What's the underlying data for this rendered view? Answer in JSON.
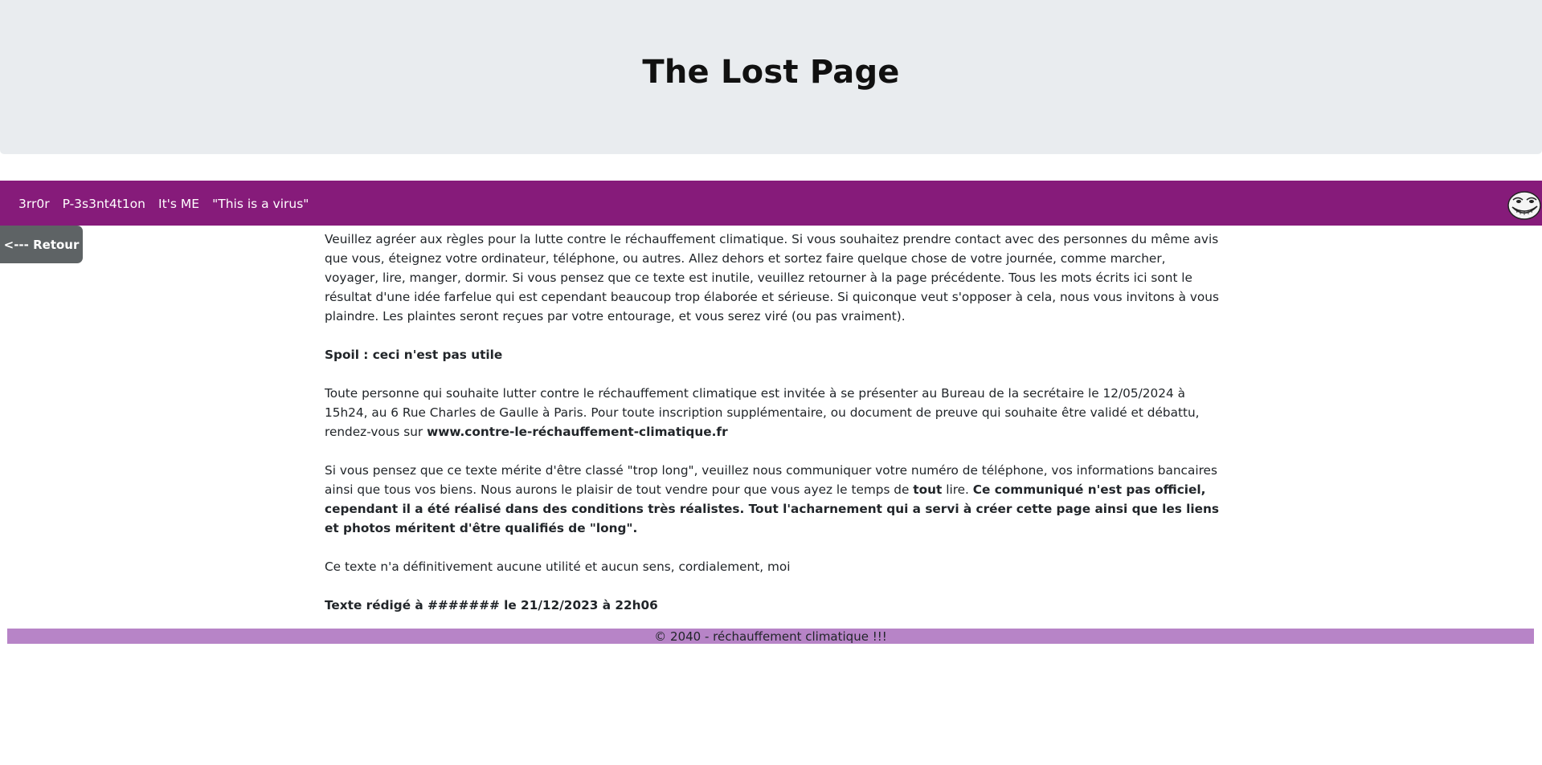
{
  "header": {
    "title": "The Lost Page"
  },
  "navbar": {
    "links": [
      "3rr0r",
      "P-3s3nt4t1on",
      "It's ME",
      "\"This is a virus\""
    ],
    "icon": "troll-face-icon"
  },
  "back_button": {
    "label": "<--- Retour"
  },
  "content": {
    "p1": "Veuillez agréer aux règles pour la lutte contre le réchauffement climatique. Si vous souhaitez prendre contact avec des personnes du même avis que vous, éteignez votre ordinateur, téléphone, ou autres. Allez dehors et sortez faire quelque chose de votre journée, comme marcher, voyager, lire, manger, dormir. Si vous pensez que ce texte est inutile, veuillez retourner à la page précédente. Tous les mots écrits ici sont le résultat d'une idée farfelue qui est cependant beaucoup trop élaborée et sérieuse. Si quiconque veut s'opposer à cela, nous vous invitons à vous plaindre. Les plaintes seront reçues par votre entourage, et vous serez viré (ou pas vraiment).",
    "spoil": "Spoil : ceci n'est pas utile",
    "p3_text": "Toute personne qui souhaite lutter contre le réchauffement climatique est invitée à se présenter au Bureau de la secrétaire le 12/05/2024 à 15h24, au 6 Rue Charles de Gaulle à Paris. Pour toute inscription supplémentaire, ou document de preuve qui souhaite être validé et débattu, rendez-vous sur ",
    "p3_link": "www.contre-le-réchauffement-climatique.fr",
    "p4_text1": "Si vous pensez que ce texte mérite d'être classé \"trop long\", veuillez nous communiquer votre numéro de téléphone, vos informations bancaires ainsi que tous vos biens. Nous aurons le plaisir de tout vendre pour que vous ayez le temps de ",
    "p4_bold1": "tout",
    "p4_text2": " lire. ",
    "p4_bold2": "Ce communiqué n'est pas officiel, cependant il a été réalisé dans des conditions très réalistes. Tout l'acharnement qui a servi à créer cette page ainsi que les liens et photos méritent d'être qualifiés de \"long\".",
    "p5": "Ce texte n'a définitivement aucune utilité et aucun sens, cordialement, moi",
    "signature": "Texte rédigé à ####### le 21/12/2023 à 22h06"
  },
  "footer": {
    "text": "© 2040 - réchauffement climatique !!!"
  },
  "colors": {
    "header_bg": "#e9ecef",
    "navbar_bg": "#861b7a",
    "button_bg": "#5e6365",
    "footer_bg": "#b784c7"
  }
}
